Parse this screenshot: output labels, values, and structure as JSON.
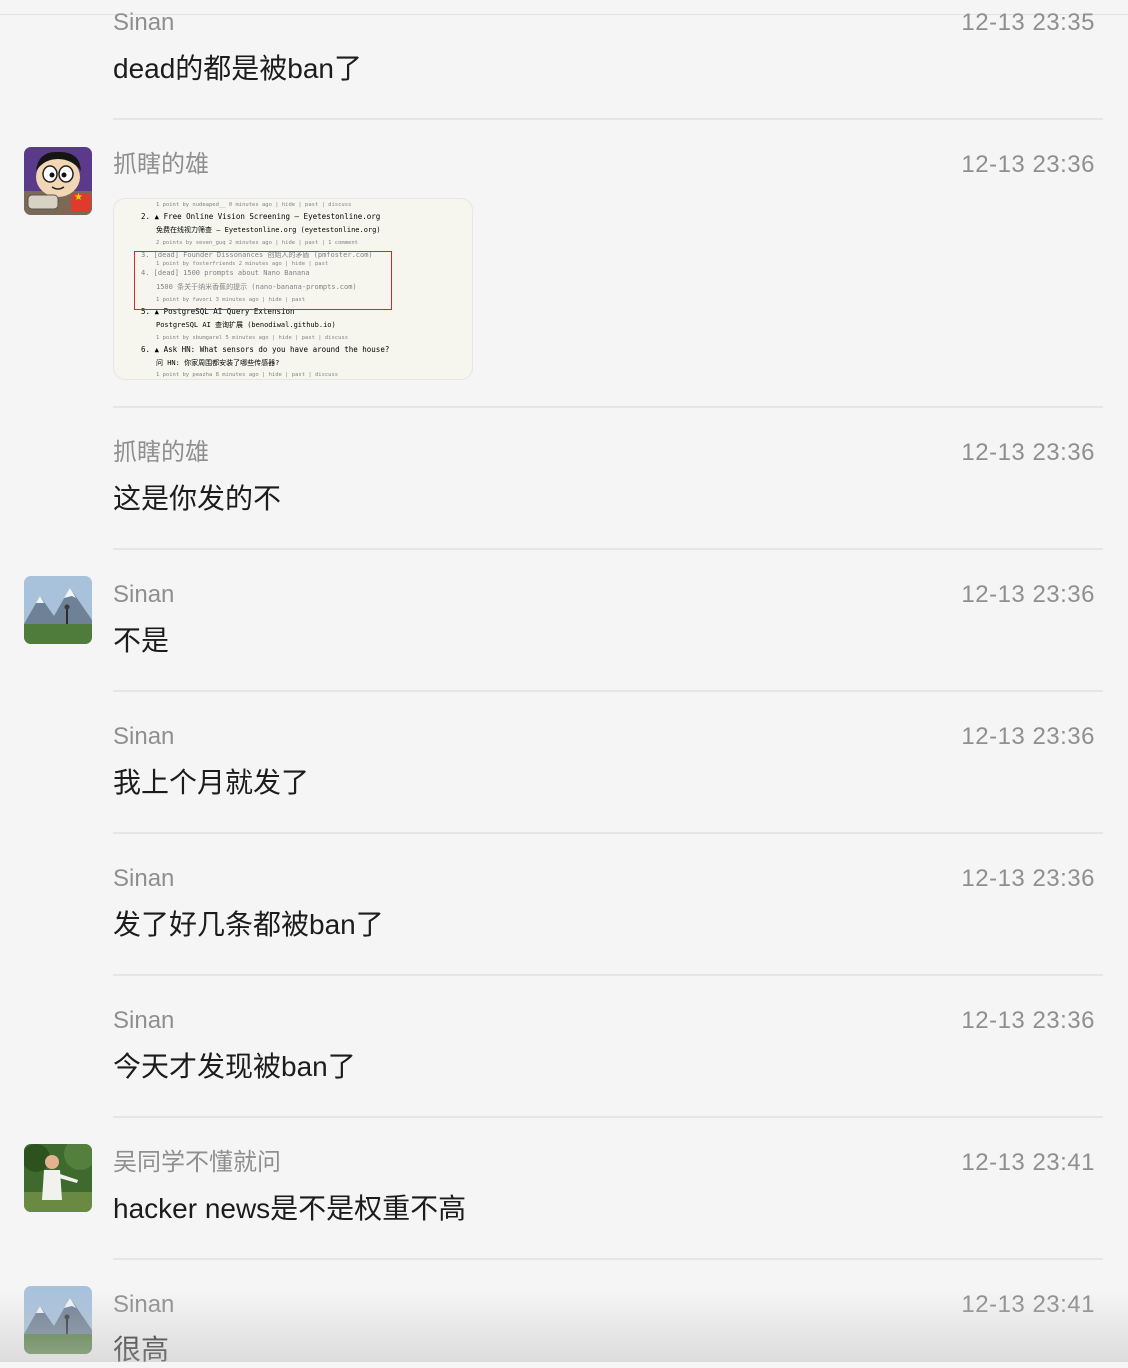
{
  "messages": [
    {
      "sender": "Sinan",
      "time": "12-13 23:35",
      "text": "dead的都是被ban了"
    },
    {
      "sender": "抓瞎的雄",
      "time": "12-13 23:36",
      "image": {
        "lines": [
          "1 point by nudeaped__ 0 minutes ago | hide | past | discuss",
          "2. ▲ Free Online Vision Screening – Eyetestonline.org",
          "免费在线视力筛查 – Eyetestonline.org (eyetestonline.org)",
          "2 points by seven_guq 2 minutes ago | hide | past | 1 comment",
          "3. [dead] Founder Dissonances 创始人的矛盾 (pmfoster.com)",
          "1 point by fosterfriends 2 minutes ago | hide | past",
          "4. [dead] 1500 prompts about Nano Banana",
          "1500 条关于纳米香蕉的提示 (nano-banana-prompts.com)",
          "1 point by favori 3 minutes ago | hide | past",
          "5. ▲ PostgreSQL AI Query Extension",
          "PostgreSQL AI 查询扩展 (benodiwal.github.io)",
          "1 point by sbumgarel 5 minutes ago | hide | past | discuss",
          "6. ▲ Ask HN: What sensors do you have around the house?",
          "问 HN: 你家周围都安装了哪些传感器?",
          "1 point by peazha 8 minutes ago | hide | past | discuss"
        ]
      }
    },
    {
      "sender": "抓瞎的雄",
      "time": "12-13 23:36",
      "text": "这是你发的不"
    },
    {
      "sender": "Sinan",
      "time": "12-13 23:36",
      "text": "不是"
    },
    {
      "sender": "Sinan",
      "time": "12-13 23:36",
      "text": "我上个月就发了"
    },
    {
      "sender": "Sinan",
      "time": "12-13 23:36",
      "text": "发了好几条都被ban了"
    },
    {
      "sender": "Sinan",
      "time": "12-13 23:36",
      "text": "今天才发现被ban了"
    },
    {
      "sender": "吴同学不懂就问",
      "time": "12-13 23:41",
      "text": "hacker news是不是权重不高"
    },
    {
      "sender": "Sinan",
      "time": "12-13 23:41",
      "text": "很高"
    }
  ],
  "avatars": {
    "cartoon": "cartoon-boy-avatar",
    "mountain": "mountain-landscape-avatar",
    "outdoor": "outdoor-person-avatar"
  }
}
